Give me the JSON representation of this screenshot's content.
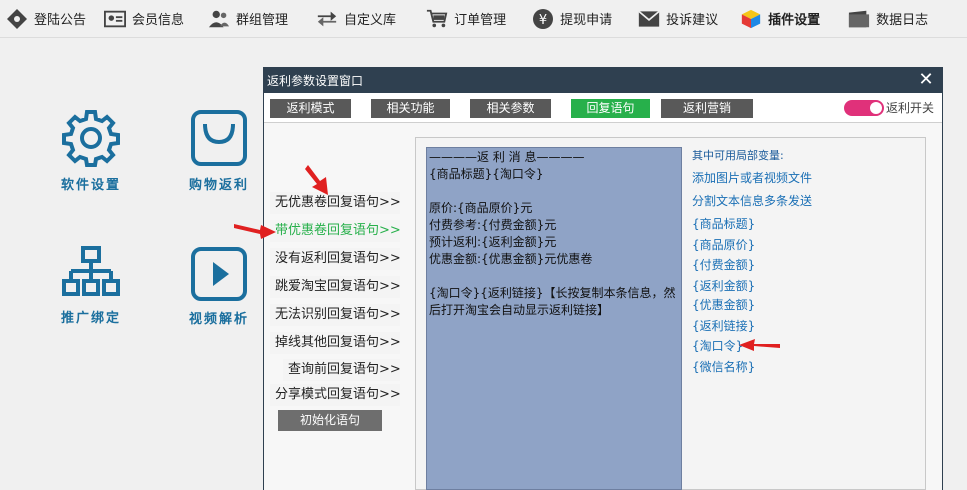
{
  "topbar": {
    "items": [
      {
        "label": "登陆公告",
        "icon": "diamond-icon"
      },
      {
        "label": "会员信息",
        "icon": "id-card-icon"
      },
      {
        "label": "群组管理",
        "icon": "group-icon"
      },
      {
        "label": "自定义库",
        "icon": "swap-arrows-icon"
      },
      {
        "label": "订单管理",
        "icon": "shopping-cart-icon"
      },
      {
        "label": "提现申请",
        "icon": "yen-coin-icon"
      },
      {
        "label": "投诉建议",
        "icon": "envelope-icon"
      },
      {
        "label": "插件设置",
        "icon": "cube-icon"
      },
      {
        "label": "数据日志",
        "icon": "folder-icon"
      }
    ]
  },
  "desktop": {
    "software_settings": "软件设置",
    "shopping_rebate": "购物返利",
    "promo_binding": "推广绑定",
    "video_parse": "视频解析"
  },
  "dialog": {
    "title": "返利参数设置窗口",
    "close": "✕",
    "tabs": [
      "返利模式",
      "相关功能",
      "相关参数",
      "回复语句",
      "返利营销"
    ],
    "active_tab": "回复语句",
    "toggle_label": "返利开关",
    "menu": [
      "无优惠卷回复语句>>",
      "带优惠卷回复语句>>",
      "没有返利回复语句>>",
      "跳爱淘宝回复语句>>",
      "无法识别回复语句>>",
      "掉线其他回复语句>>",
      "查询前回复语句>>",
      "分享模式回复语句>>"
    ],
    "init_button": "初始化语句",
    "message": "————返 利 消 息————\n{商品标题}{淘口令}\n\n原价:{商品原价}元\n付费参考:{付费金额}元\n预计返利:{返利金额}元\n优惠金额:{优惠金额}元优惠卷\n\n{淘口令}{返利链接}【长按复制本条信息，然后打开淘宝会自动显示返利链接】",
    "vars_title": "其中可用局部变量:",
    "vars": [
      "添加图片或者视频文件",
      "分割文本信息多条发送",
      "{商品标题}",
      "{商品原价}",
      "{付费金额}",
      "{返利金额}",
      "{优惠金额}",
      "{返利链接}",
      "{淘口令}",
      "{微信名称}"
    ]
  },
  "colors": {
    "title_bar": "#2f4050",
    "active_tab": "#27b04b",
    "tab": "#595959",
    "toggle": "#e0317a",
    "icon_blue": "#1b6f9e",
    "message_bg": "#8fa3c6",
    "arrow": "#e02020"
  }
}
